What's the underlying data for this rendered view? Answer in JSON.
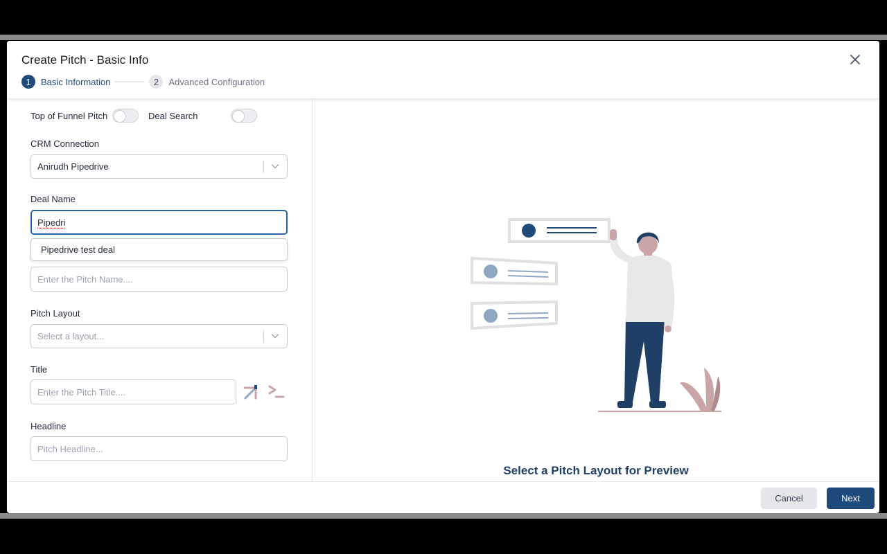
{
  "header": {
    "title": "Create Pitch - Basic Info",
    "steps": [
      {
        "number": "1",
        "label": "Basic Information",
        "state": "active"
      },
      {
        "number": "2",
        "label": "Advanced Configuration",
        "state": "inactive"
      }
    ]
  },
  "form": {
    "top_of_funnel_label": "Top of Funnel Pitch",
    "top_of_funnel_on": false,
    "deal_search_label": "Deal Search",
    "deal_search_on": false,
    "crm_label": "CRM Connection",
    "crm_value": "Anirudh Pipedrive",
    "deal_name_label": "Deal Name",
    "deal_name_value": "Pipedri",
    "deal_suggestion": "Pipedrive test deal",
    "pitch_name_placeholder": "Enter the Pitch Name....",
    "pitch_layout_label": "Pitch Layout",
    "pitch_layout_placeholder": "Select a layout...",
    "title_label": "Title",
    "title_placeholder": "Enter the Pitch Title....",
    "headline_label": "Headline",
    "headline_placeholder": "Pitch Headline..."
  },
  "preview": {
    "caption": "Select a Pitch Layout for Preview"
  },
  "footer": {
    "cancel_label": "Cancel",
    "next_label": "Next"
  },
  "colors": {
    "primary": "#1f4a7c",
    "accent_pink": "#c9a5a8",
    "muted_blue": "#8fa6c4"
  }
}
